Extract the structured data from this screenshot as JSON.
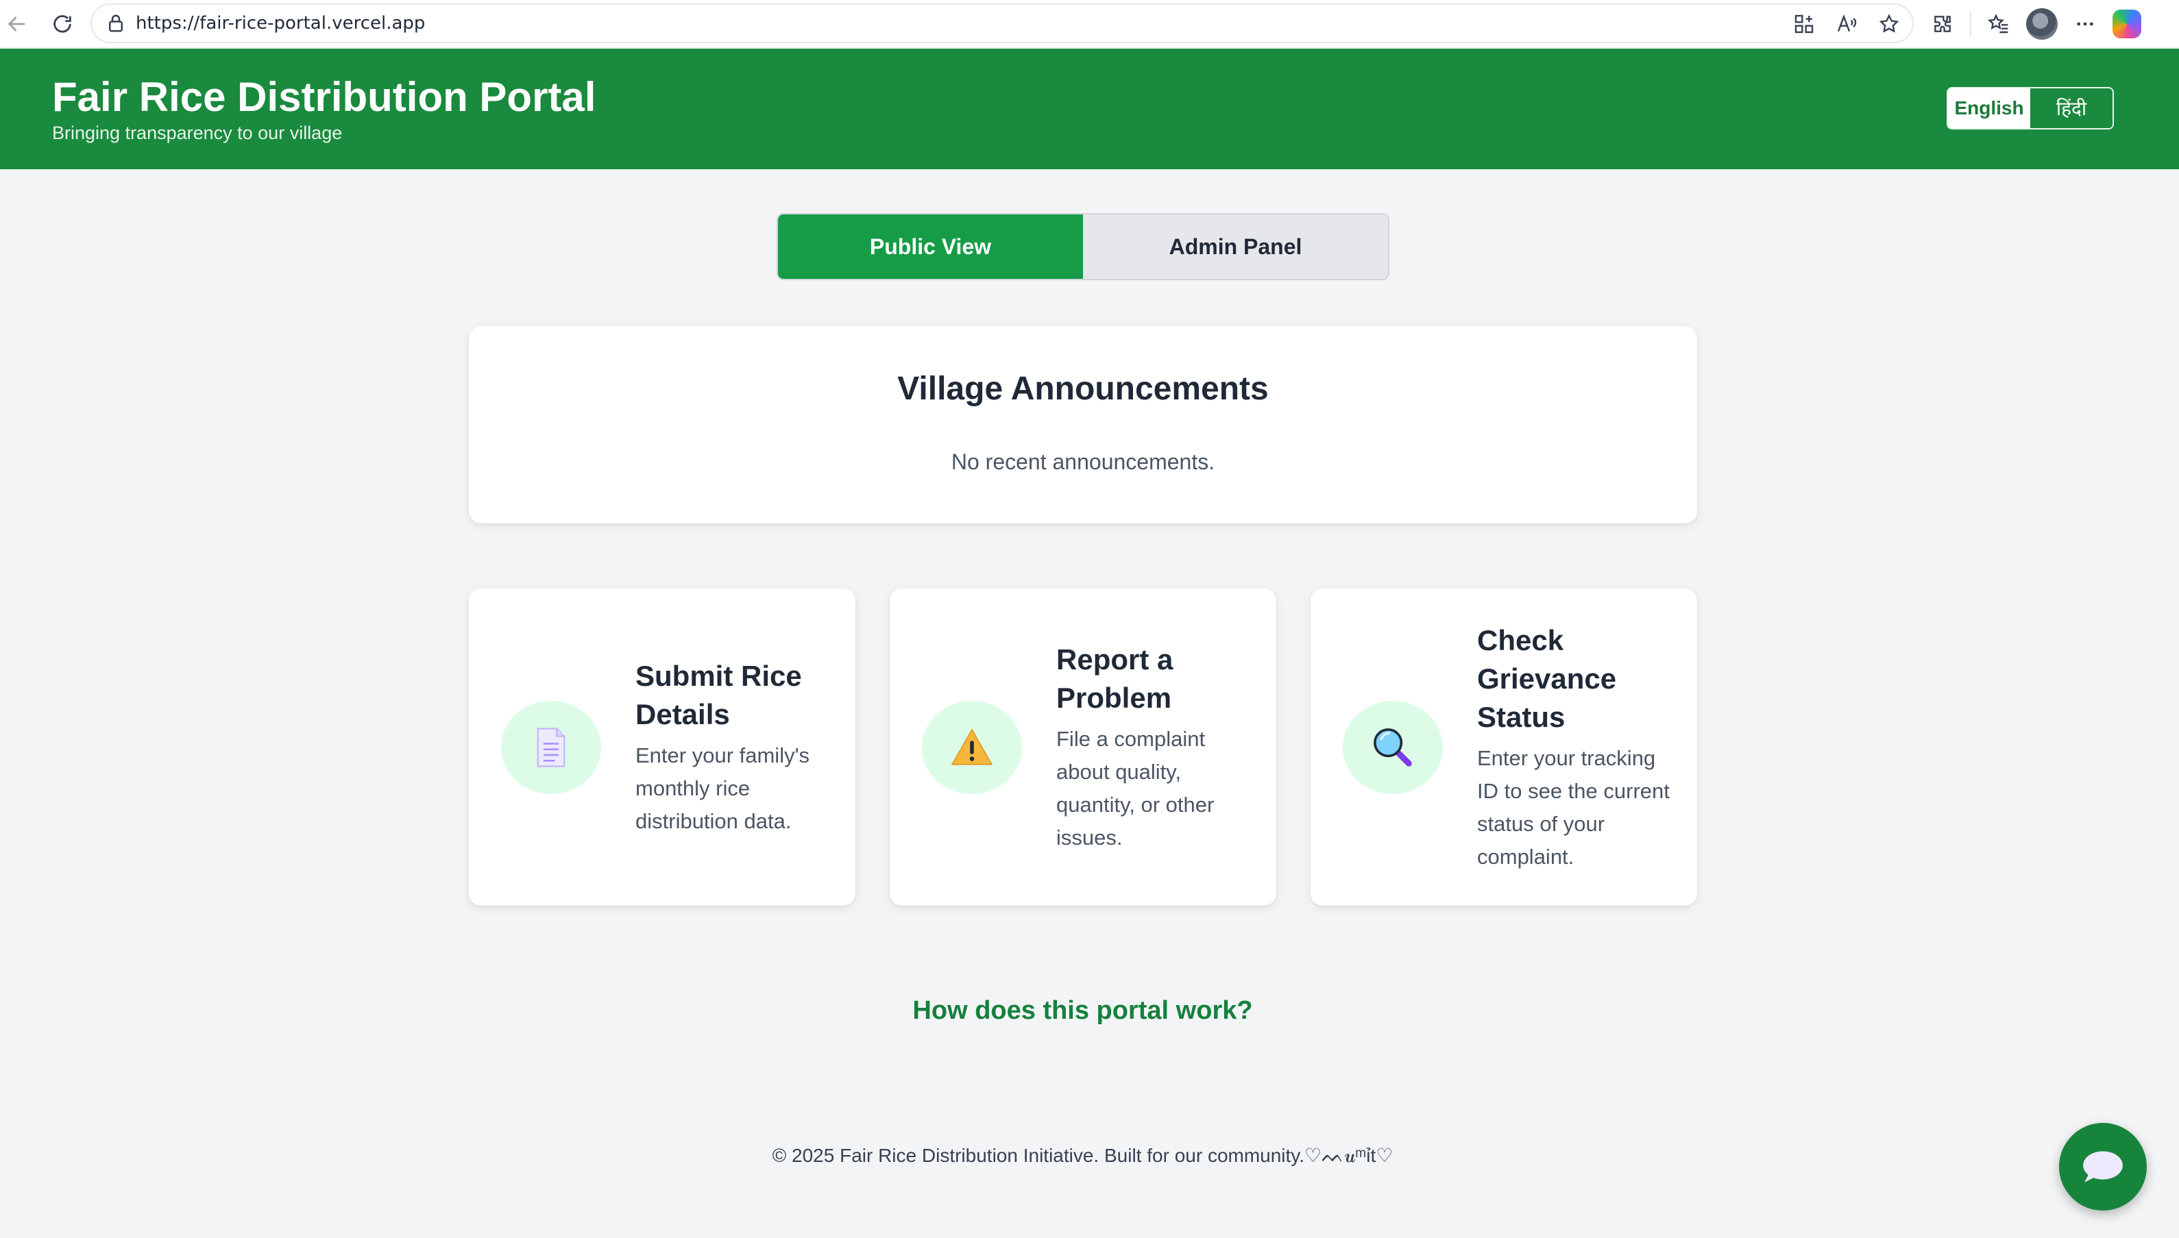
{
  "browser": {
    "url": "https://fair-rice-portal.vercel.app"
  },
  "header": {
    "title": "Fair Rice Distribution Portal",
    "subtitle": "Bringing transparency to our village",
    "languages": [
      "English",
      "हिंदी"
    ],
    "active_language": "English"
  },
  "tabs": [
    {
      "label": "Public View",
      "active": true
    },
    {
      "label": "Admin Panel",
      "active": false
    }
  ],
  "announcements": {
    "title": "Village Announcements",
    "empty_text": "No recent announcements."
  },
  "features": [
    {
      "icon": "document-icon",
      "title": "Submit Rice Details",
      "description": "Enter your family's monthly rice distribution data."
    },
    {
      "icon": "warning-icon",
      "title": "Report a Problem",
      "description": "File a complaint about quality, quantity, or other issues."
    },
    {
      "icon": "magnifier-icon",
      "title": "Check Grievance Status",
      "description": "Enter your tracking ID to see the current status of your complaint."
    }
  ],
  "help_link": "How does this portal work?",
  "footer": {
    "text": "© 2025 Fair Rice Distribution Initiative. Built for our community.♡ᨓ𝒖ᵐỉt♡"
  },
  "colors": {
    "header_green": "#1a8a3e",
    "tab_active_green": "#169c46",
    "link_green": "#15803d",
    "icon_circle": "#dcfce7",
    "page_bg": "#f3f4f6"
  },
  "chat": {
    "icon": "chat-bubble-icon"
  }
}
